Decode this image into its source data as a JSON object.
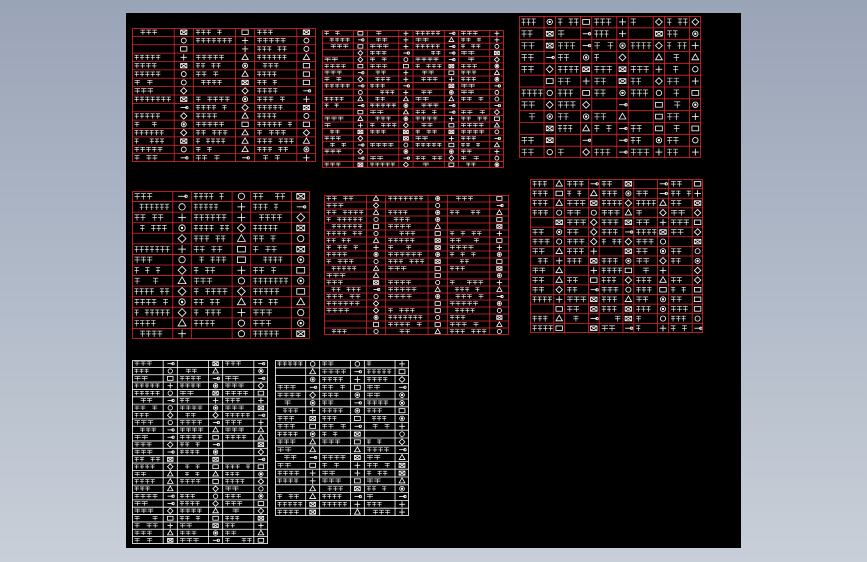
{
  "viewport": {
    "background": "#000000",
    "page_background": "#a9b3c3"
  },
  "colors": {
    "red_table": "#e0242c",
    "white_table": "#ffffff",
    "annotation": "#ffffff"
  },
  "tables": [
    {
      "id": "legend-1",
      "color": "red",
      "cols": 6,
      "rows": 16,
      "icon_cols": [
        1,
        3,
        5
      ]
    },
    {
      "id": "legend-2",
      "color": "red",
      "cols": 8,
      "rows": 21,
      "icon_cols": [
        1,
        3,
        5,
        7
      ]
    },
    {
      "id": "legend-3",
      "color": "red",
      "cols": 10,
      "rows": 12,
      "icon_cols": [
        1,
        3,
        5,
        7,
        9
      ]
    },
    {
      "id": "legend-4",
      "color": "red",
      "cols": 6,
      "rows": 14,
      "icon_cols": [
        1,
        3,
        5
      ]
    },
    {
      "id": "legend-5",
      "color": "red",
      "cols": 6,
      "rows": 20,
      "icon_cols": [
        1,
        3,
        5
      ]
    },
    {
      "id": "legend-6",
      "color": "red",
      "cols": 10,
      "rows": 16,
      "icon_cols": [
        1,
        3,
        5,
        7,
        9
      ]
    },
    {
      "id": "legend-7",
      "color": "white",
      "cols": 6,
      "rows": 25,
      "icon_cols": [
        1,
        3,
        5
      ]
    },
    {
      "id": "legend-8",
      "color": "white",
      "cols": 6,
      "rows": 20,
      "icon_cols": [
        1,
        3,
        5
      ]
    }
  ]
}
